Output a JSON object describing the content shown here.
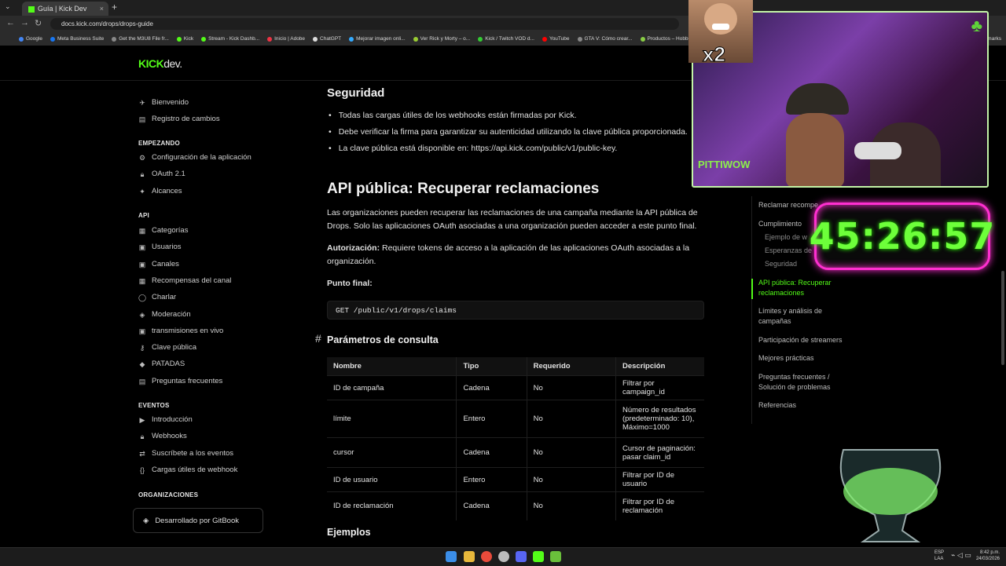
{
  "browser": {
    "tab_title": "Guía | Kick Dev",
    "new_tab": "+",
    "url": "docs.kick.com/drops/drops-guide",
    "bookmarks": [
      "Google",
      "Meta Business Suite",
      "Get the M3U8 File fr...",
      "Kick",
      "Stream - Kick Dashb...",
      "Inicio | Adobe",
      "ChatGPT",
      "Mejorar imagen onli...",
      "Ver Rick y Morty – o...",
      "Kick / Twitch VOD d...",
      "YouTube",
      "GTA V: Cómo crear...",
      "Productos – Hobbie..."
    ],
    "bookmarks_right": "marks"
  },
  "site": {
    "logo_kick": "KICK",
    "logo_dev": "dev."
  },
  "sidebar": {
    "top": [
      {
        "icon": "rocket-icon",
        "label": "Bienvenido"
      },
      {
        "icon": "document-icon",
        "label": "Registro de cambios"
      }
    ],
    "heading_start": "EMPEZANDO",
    "start": [
      {
        "icon": "gear-icon",
        "label": "Configuración de la aplicación"
      },
      {
        "icon": "lock-icon",
        "label": "OAuth 2.1"
      },
      {
        "icon": "wand-icon",
        "label": "Alcances"
      }
    ],
    "heading_api": "API",
    "api": [
      {
        "icon": "grid-icon",
        "label": "Categorías"
      },
      {
        "icon": "user-icon",
        "label": "Usuarios"
      },
      {
        "icon": "channel-icon",
        "label": "Canales"
      },
      {
        "icon": "gift-icon",
        "label": "Recompensas del canal"
      },
      {
        "icon": "chat-icon",
        "label": "Charlar"
      },
      {
        "icon": "shield-icon",
        "label": "Moderación"
      },
      {
        "icon": "broadcast-icon",
        "label": "transmisiones en vivo"
      },
      {
        "icon": "key-icon",
        "label": "Clave pública"
      },
      {
        "icon": "diamond-icon",
        "label": "PATADAS"
      },
      {
        "icon": "faq-icon",
        "label": "Preguntas frecuentes"
      }
    ],
    "heading_events": "EVENTOS",
    "events": [
      {
        "icon": "play-icon",
        "label": "Introducción"
      },
      {
        "icon": "lock-icon",
        "label": "Webhooks"
      },
      {
        "icon": "subscribe-icon",
        "label": "Suscríbete a los eventos"
      },
      {
        "icon": "braces-icon",
        "label": "Cargas útiles de webhook"
      }
    ],
    "heading_orgs": "ORGANIZACIONES",
    "gitbook": "Desarrollado por GitBook"
  },
  "main": {
    "security_title": "Seguridad",
    "security_bullets": [
      "Todas las cargas útiles de los webhooks están firmadas por Kick.",
      "Debe verificar la firma para garantizar su autenticidad utilizando la clave pública proporcionada.",
      "La clave pública está disponible en: https://api.kick.com/public/v1/public-key."
    ],
    "api_title": "API pública: Recuperar reclamaciones",
    "api_para": "Las organizaciones pueden recuperar las reclamaciones de una campaña mediante la API pública de Drops. Solo las aplicaciones OAuth asociadas a una organización pueden acceder a este punto final.",
    "auth_label": "Autorización:",
    "auth_text": " Requiere tokens de acceso a la aplicación de las aplicaciones OAuth asociadas a la organización.",
    "endpoint_label": "Punto final:",
    "endpoint_code": "GET /public/v1/drops/claims",
    "params_hash": "#",
    "params_title": "Parámetros de consulta",
    "table_headers": [
      "Nombre",
      "Tipo",
      "Requerido",
      "Descripción"
    ],
    "table_rows": [
      [
        "ID de campaña",
        "Cadena",
        "No",
        "Filtrar por campaign_id"
      ],
      [
        "límite",
        "Entero",
        "No",
        "Número de resultados (predeterminado: 10), Máximo=1000"
      ],
      [
        "cursor",
        "Cadena",
        "No",
        "Cursor de paginación: pasar claim_id"
      ],
      [
        "ID de usuario",
        "Entero",
        "No",
        "Filtrar por ID de usuario"
      ],
      [
        "ID de reclamación",
        "Cadena",
        "No",
        "Filtrar por ID de reclamación"
      ]
    ],
    "examples_title": "Ejemplos"
  },
  "toc": {
    "items": [
      {
        "label": "Reclamar recompe",
        "type": "item"
      },
      {
        "label": "Cumplimiento",
        "type": "item"
      },
      {
        "label": "Ejemplo de w",
        "type": "sub"
      },
      {
        "label": "Esperanzas de",
        "type": "sub"
      },
      {
        "label": "Seguridad",
        "type": "sub"
      },
      {
        "label": "API pública: Recuperar reclamaciones",
        "type": "active"
      },
      {
        "label": "Límites y análisis de campañas",
        "type": "item"
      },
      {
        "label": "Participación de streamers",
        "type": "item"
      },
      {
        "label": "Mejores prácticas",
        "type": "item"
      },
      {
        "label": "Preguntas frecuentes / Solución de problemas",
        "type": "item"
      },
      {
        "label": "Referencias",
        "type": "item"
      }
    ]
  },
  "overlay": {
    "meme_multiplier": "x2",
    "streamer_tag": "PITTIWOW",
    "timer": "45:26:57"
  },
  "taskbar": {
    "lang1": "ESP",
    "lang2": "LAA",
    "time": "8:42 p.m.",
    "date": "24/03/2026"
  }
}
